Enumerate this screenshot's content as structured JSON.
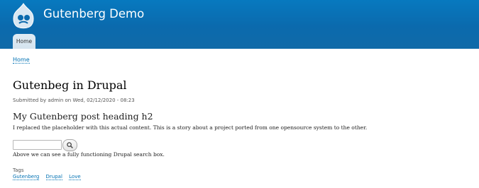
{
  "site": {
    "name": "Gutenberg Demo",
    "logo_icon": "drupal-drop-logo"
  },
  "nav": {
    "tabs": [
      {
        "label": "Home",
        "active": true
      }
    ]
  },
  "breadcrumb": {
    "items": [
      "Home"
    ]
  },
  "node": {
    "title": "Gutenbeg in Drupal",
    "submitted": "Submitted by admin on Wed, 02/12/2020 - 08:23",
    "heading": "My Gutenberg post heading h2",
    "paragraph": "I replaced the placeholder with this actual content. This is a story about a project ported from one opensource system to the other.",
    "search": {
      "value": "",
      "placeholder": "",
      "button_icon": "search-icon"
    },
    "after_search_text": "Above we can see a fully functioning Drupal search box.",
    "tags_label": "Tags",
    "tags": [
      "Gutenberg",
      "Drupal",
      "Love"
    ]
  },
  "colors": {
    "header_top": "#0779bf",
    "header_bottom": "#106aa8",
    "link": "#0071b3"
  }
}
